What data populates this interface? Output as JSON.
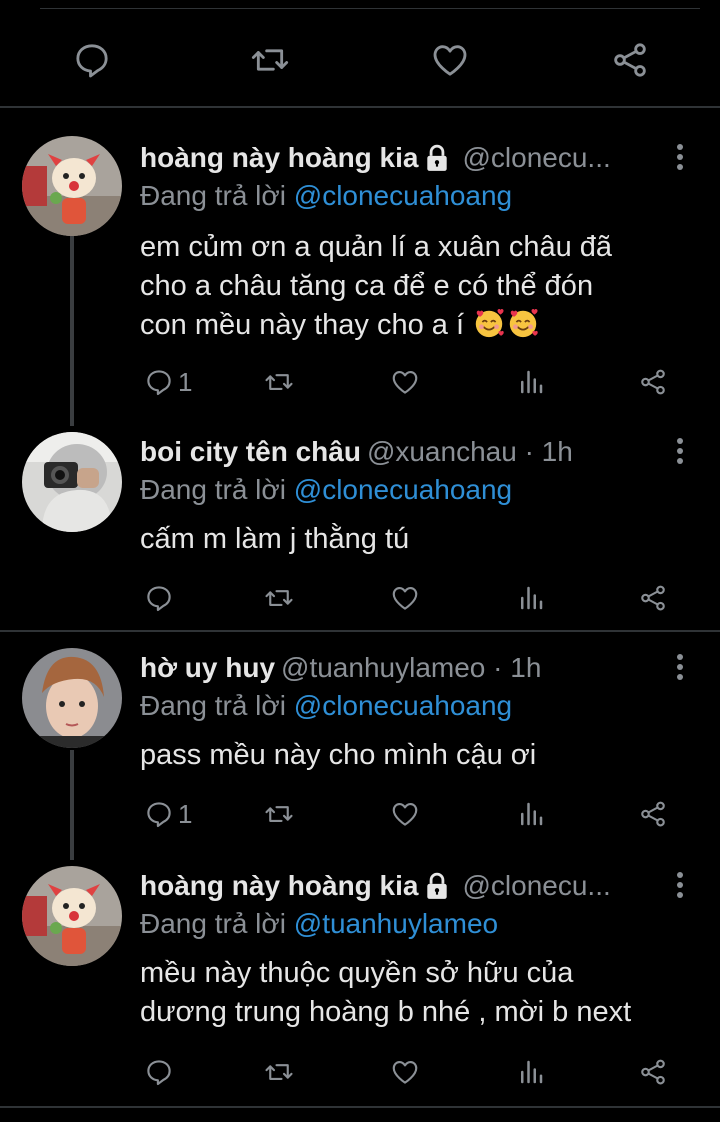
{
  "colors": {
    "background": "#000000",
    "text": "#e6e6e6",
    "muted": "#8b9096",
    "link": "#2f8fd6",
    "divider": "#2f3336"
  },
  "top_actions": [
    "reply-icon",
    "retweet-icon",
    "like-icon",
    "share-icon"
  ],
  "tweets": [
    {
      "name": "hoàng này hoàng kia",
      "locked": true,
      "handle": "@clonecu...",
      "reply_prefix": "Đang trả lời ",
      "reply_to": "@clonecuahoang",
      "text_lines": [
        "em củm ơn a quản lí a xuân châu đã",
        "cho a châu tăng ca để e có thể đón",
        "con mều này thay cho a í"
      ],
      "emoji": [
        "smiling-face-with-hearts",
        "smiling-face-with-hearts"
      ],
      "reply_count": "1"
    },
    {
      "name": "boi city tên châu",
      "locked": false,
      "handle": "@xuanchau · 1h",
      "reply_prefix": "Đang trả lời ",
      "reply_to": "@clonecuahoang",
      "text_lines": [
        "cấm m làm j thằng tú"
      ],
      "reply_count": ""
    },
    {
      "name": "hờ uy huy",
      "locked": false,
      "handle": "@tuanhuylameo · 1h",
      "reply_prefix": "Đang trả lời ",
      "reply_to": "@clonecuahoang",
      "text_lines": [
        "pass mều này cho mình cậu ơi"
      ],
      "reply_count": "1"
    },
    {
      "name": "hoàng này hoàng kia",
      "locked": true,
      "handle": "@clonecu...",
      "reply_prefix": "Đang trả lời ",
      "reply_to": "@tuanhuylameo",
      "text_lines": [
        "mều này thuộc quyền sở hữu của",
        "dương trung hoàng b nhé , mời b next"
      ],
      "reply_count": ""
    }
  ]
}
